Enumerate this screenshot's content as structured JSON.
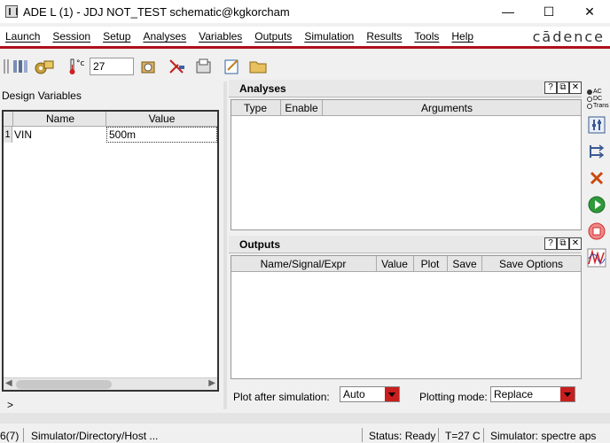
{
  "window": {
    "title": "ADE L (1) - JDJ NOT_TEST schematic@kgkorcham",
    "minimize": "—",
    "maximize": "☐",
    "close": "✕"
  },
  "menu": [
    "Launch",
    "Session",
    "Setup",
    "Analyses",
    "Variables",
    "Outputs",
    "Simulation",
    "Results",
    "Tools",
    "Help"
  ],
  "brand": "cādence",
  "toolbar": {
    "temperature_value": "27",
    "temp_label": "°c",
    "icons": [
      "grip-icon",
      "session-icon",
      "load-state-icon",
      "temperature-icon",
      "setup-icon",
      "probe-icon",
      "save-icon",
      "edit-icon",
      "open-folder-icon"
    ]
  },
  "design_variables": {
    "title": "Design Variables",
    "columns": [
      "Name",
      "Value"
    ],
    "rows": [
      {
        "num": "1",
        "name": "VIN",
        "value": "500m"
      }
    ]
  },
  "analyses": {
    "title": "Analyses",
    "columns": [
      "Type",
      "Enable",
      "Arguments"
    ],
    "help": "?",
    "float": "⧉",
    "close": "✕"
  },
  "outputs": {
    "title": "Outputs",
    "columns": [
      "Name/Signal/Expr",
      "Value",
      "Plot",
      "Save",
      "Save Options"
    ],
    "help": "?",
    "float": "⧉",
    "close": "✕"
  },
  "plot_options": {
    "plot_after_label": "Plot after simulation:",
    "plot_after_value": "Auto",
    "plotting_mode_label": "Plotting mode:",
    "plotting_mode_value": "Replace"
  },
  "side_toolbar": {
    "radio_ac": "AC",
    "radio_dc": "DC",
    "radio_trans": "Trans"
  },
  "command_prompt": ">",
  "status": {
    "line": "6(7)",
    "path": "Simulator/Directory/Host ...",
    "state": "Status: Ready",
    "temp": "T=27 C",
    "simulator": "Simulator: spectre aps"
  },
  "colors": {
    "accent_red": "#b0101c",
    "run_green": "#2e9a3a",
    "stop_red": "#d03030"
  }
}
